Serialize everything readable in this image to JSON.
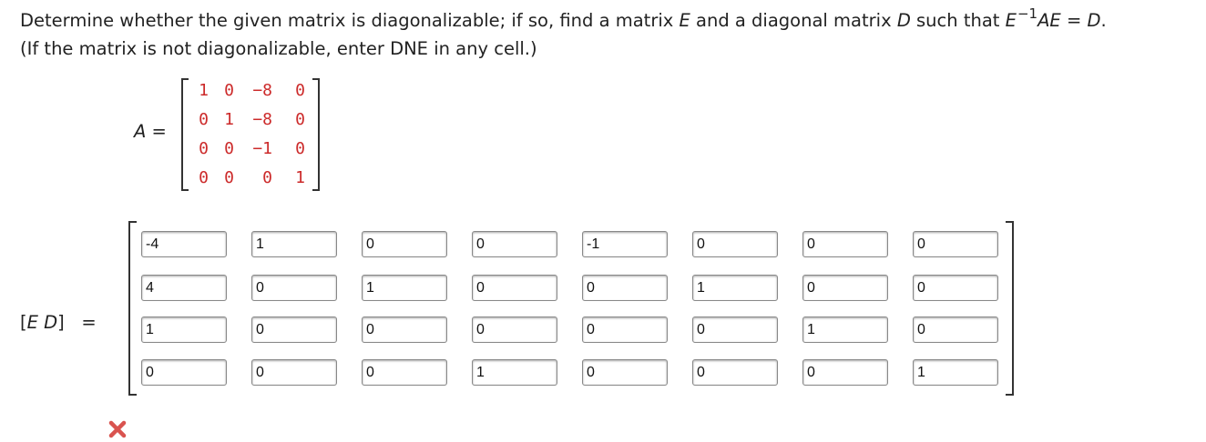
{
  "question": {
    "line1_prefix": "Determine whether the given matrix is diagonalizable; if so, find a matrix ",
    "E": "E",
    "line1_mid": " and a diagonal matrix ",
    "D": "D",
    "line1_mid2": " such that ",
    "E2": "E",
    "sup": "−1",
    "AE": "AE",
    "eq": " = ",
    "D2": "D",
    "period": ".",
    "line2": "(If the matrix is not diagonalizable, enter DNE in any cell.)"
  },
  "matrix_a": {
    "name": "A",
    "eq": " =",
    "rows": [
      [
        "1",
        "0",
        "−8",
        "0"
      ],
      [
        "0",
        "1",
        "−8",
        "0"
      ],
      [
        "0",
        "0",
        "−1",
        "0"
      ],
      [
        "0",
        "0",
        "0",
        "1"
      ]
    ]
  },
  "answer": {
    "label_open": "[",
    "label_E": "E",
    "label_space": " ",
    "label_D": "D",
    "label_close": "]",
    "label_eq": "=",
    "rows": [
      [
        "-4",
        "1",
        "0",
        "0",
        "-1",
        "0",
        "0",
        "0"
      ],
      [
        "4",
        "0",
        "1",
        "0",
        "0",
        "1",
        "0",
        "0"
      ],
      [
        "1",
        "0",
        "0",
        "0",
        "0",
        "0",
        "1",
        "0"
      ],
      [
        "0",
        "0",
        "0",
        "1",
        "0",
        "0",
        "0",
        "1"
      ]
    ]
  },
  "status": {
    "icon": "incorrect-x-icon",
    "color": "#d9534f"
  }
}
